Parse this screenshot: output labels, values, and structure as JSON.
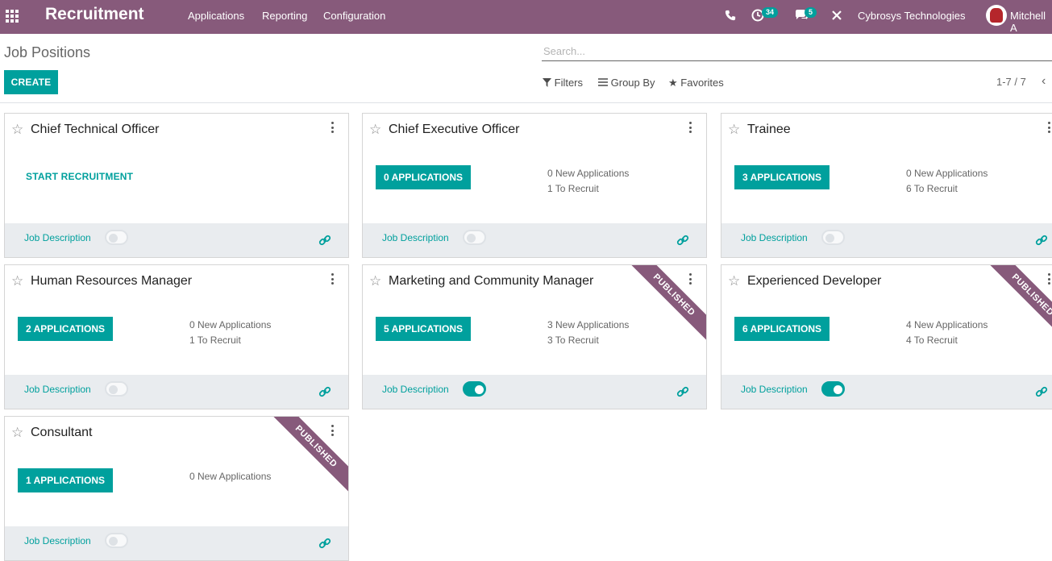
{
  "navbar": {
    "app_title": "Recruitment",
    "menu": [
      "Applications",
      "Reporting",
      "Configuration"
    ],
    "activity_count": "34",
    "message_count": "5",
    "company": "Cybrosys Technologies",
    "user": "Mitchell A"
  },
  "control": {
    "page_title": "Job Positions",
    "create_label": "CREATE",
    "search_placeholder": "Search...",
    "filters_label": "Filters",
    "groupby_label": "Group By",
    "favorites_label": "Favorites",
    "pager": "1-7 / 7"
  },
  "cards": [
    {
      "title": "Chief Technical Officer",
      "button": "START RECRUITMENT",
      "new_apps": "",
      "to_recruit": "",
      "jd_label": "Job Description",
      "jd_on": false,
      "published": false
    },
    {
      "title": "Chief Executive Officer",
      "button": "0 APPLICATIONS",
      "new_apps": "0 New Applications",
      "to_recruit": "1 To Recruit",
      "jd_label": "Job Description",
      "jd_on": false,
      "published": false
    },
    {
      "title": "Trainee",
      "button": "3 APPLICATIONS",
      "new_apps": "0 New Applications",
      "to_recruit": "6 To Recruit",
      "jd_label": "Job Description",
      "jd_on": false,
      "published": false
    },
    {
      "title": "Human Resources Manager",
      "button": "2 APPLICATIONS",
      "new_apps": "0 New Applications",
      "to_recruit": "1 To Recruit",
      "jd_label": "Job Description",
      "jd_on": false,
      "published": false
    },
    {
      "title": "Marketing and Community Manager",
      "button": "5 APPLICATIONS",
      "new_apps": "3 New Applications",
      "to_recruit": "3 To Recruit",
      "jd_label": "Job Description",
      "jd_on": true,
      "published": true,
      "ribbon": "PUBLISHED"
    },
    {
      "title": "Experienced Developer",
      "button": "6 APPLICATIONS",
      "new_apps": "4 New Applications",
      "to_recruit": "4 To Recruit",
      "jd_label": "Job Description",
      "jd_on": true,
      "published": true,
      "ribbon": "PUBLISHED"
    },
    {
      "title": "Consultant",
      "button": "1 APPLICATIONS",
      "new_apps": "0 New Applications",
      "to_recruit": "",
      "jd_label": "Job Description",
      "jd_on": false,
      "published": true,
      "ribbon": "PUBLISHED"
    }
  ],
  "colors": {
    "brand": "#875a7b",
    "accent": "#00a09d"
  }
}
